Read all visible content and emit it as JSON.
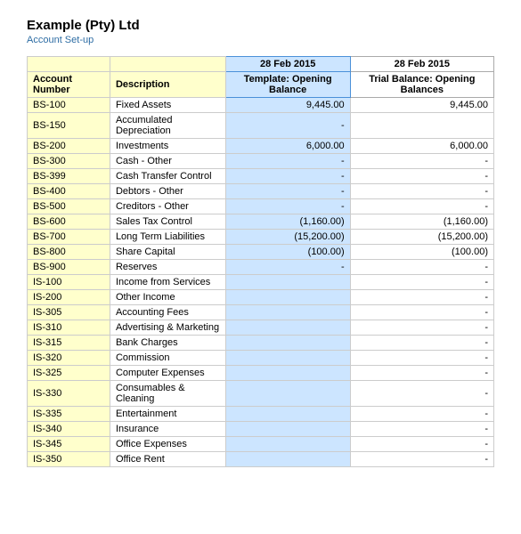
{
  "company": {
    "name": "Example (Pty) Ltd",
    "subtitle": "Account Set-up"
  },
  "table": {
    "headers": {
      "date1": "28 Feb 2015",
      "date2": "28 Feb 2015",
      "col1": "Account Number",
      "col2": "Description",
      "col3": "Template: Opening Balance",
      "col4": "Trial Balance: Opening Balances"
    },
    "rows": [
      {
        "account": "BS-100",
        "desc": "Fixed Assets",
        "template": "9,445.00",
        "trial": "9,445.00"
      },
      {
        "account": "BS-150",
        "desc": "Accumulated Depreciation",
        "template": "-",
        "trial": ""
      },
      {
        "account": "BS-200",
        "desc": "Investments",
        "template": "6,000.00",
        "trial": "6,000.00"
      },
      {
        "account": "BS-300",
        "desc": "Cash - Other",
        "template": "-",
        "trial": "-"
      },
      {
        "account": "BS-399",
        "desc": "Cash Transfer Control",
        "template": "-",
        "trial": "-"
      },
      {
        "account": "BS-400",
        "desc": "Debtors - Other",
        "template": "-",
        "trial": "-"
      },
      {
        "account": "BS-500",
        "desc": "Creditors - Other",
        "template": "-",
        "trial": "-"
      },
      {
        "account": "BS-600",
        "desc": "Sales Tax Control",
        "template": "(1,160.00)",
        "trial": "(1,160.00)"
      },
      {
        "account": "BS-700",
        "desc": "Long Term Liabilities",
        "template": "(15,200.00)",
        "trial": "(15,200.00)"
      },
      {
        "account": "BS-800",
        "desc": "Share Capital",
        "template": "(100.00)",
        "trial": "(100.00)"
      },
      {
        "account": "BS-900",
        "desc": "Reserves",
        "template": "-",
        "trial": "-"
      },
      {
        "account": "IS-100",
        "desc": "Income from Services",
        "template": "",
        "trial": "-"
      },
      {
        "account": "IS-200",
        "desc": "Other Income",
        "template": "",
        "trial": "-"
      },
      {
        "account": "IS-305",
        "desc": "Accounting Fees",
        "template": "",
        "trial": "-"
      },
      {
        "account": "IS-310",
        "desc": "Advertising & Marketing",
        "template": "",
        "trial": "-"
      },
      {
        "account": "IS-315",
        "desc": "Bank Charges",
        "template": "",
        "trial": "-"
      },
      {
        "account": "IS-320",
        "desc": "Commission",
        "template": "",
        "trial": "-"
      },
      {
        "account": "IS-325",
        "desc": "Computer Expenses",
        "template": "",
        "trial": "-"
      },
      {
        "account": "IS-330",
        "desc": "Consumables & Cleaning",
        "template": "",
        "trial": "-"
      },
      {
        "account": "IS-335",
        "desc": "Entertainment",
        "template": "",
        "trial": "-"
      },
      {
        "account": "IS-340",
        "desc": "Insurance",
        "template": "",
        "trial": "-"
      },
      {
        "account": "IS-345",
        "desc": "Office Expenses",
        "template": "",
        "trial": "-"
      },
      {
        "account": "IS-350",
        "desc": "Office Rent",
        "template": "",
        "trial": "-"
      }
    ]
  }
}
